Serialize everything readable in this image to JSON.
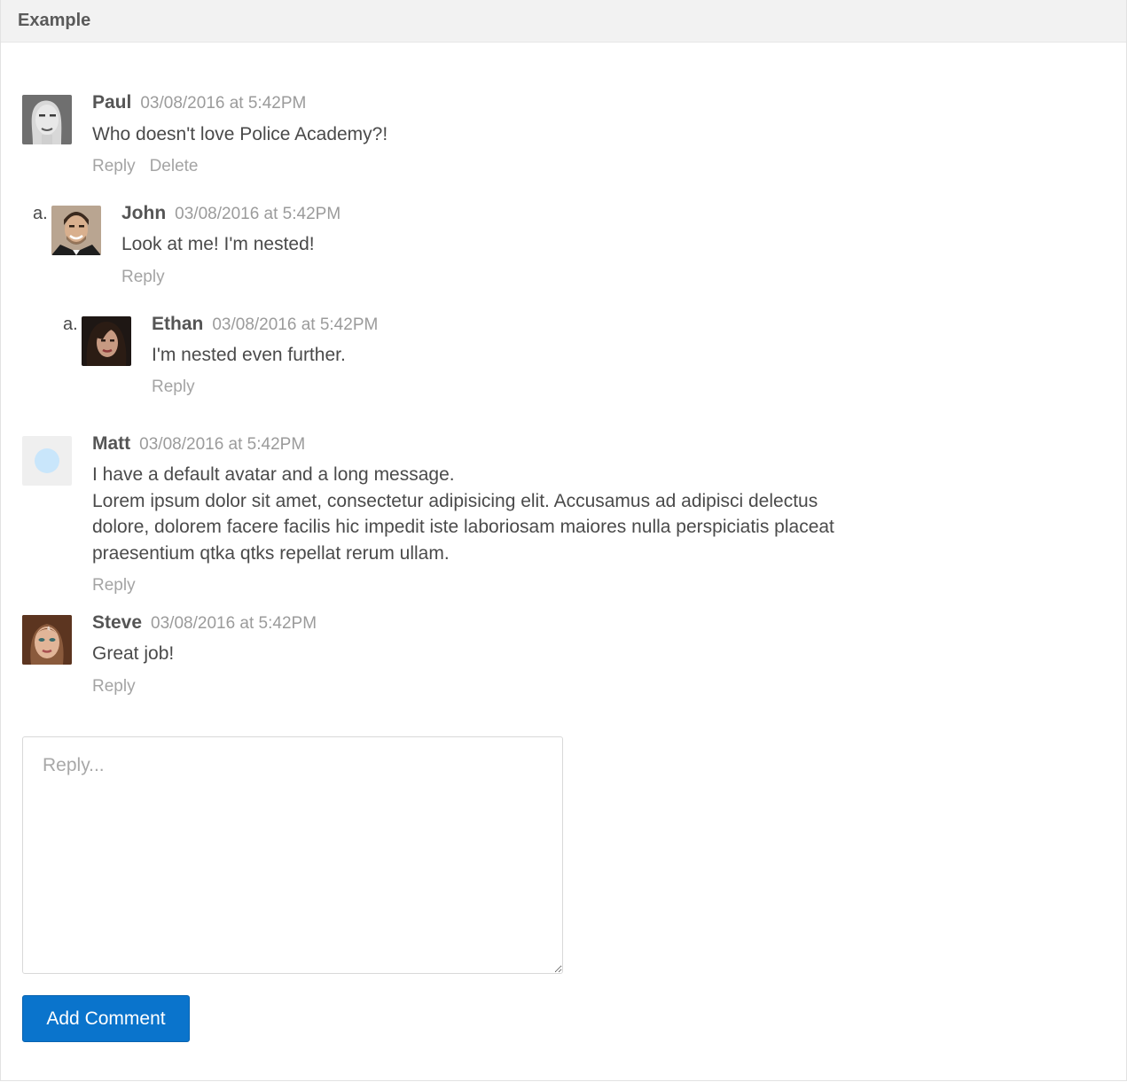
{
  "header": {
    "title": "Example"
  },
  "comments": [
    {
      "author": "Paul",
      "timestamp": "03/08/2016 at 5:42PM",
      "message": [
        "Who doesn't love Police Academy?!"
      ],
      "actions": {
        "reply": "Reply",
        "delete": "Delete"
      }
    },
    {
      "marker": "a.",
      "author": "John",
      "timestamp": "03/08/2016 at 5:42PM",
      "message": [
        "Look at me! I'm nested!"
      ],
      "actions": {
        "reply": "Reply"
      }
    },
    {
      "marker": "a.",
      "author": "Ethan",
      "timestamp": "03/08/2016 at 5:42PM",
      "message": [
        "I'm nested even further."
      ],
      "actions": {
        "reply": "Reply"
      }
    },
    {
      "author": "Matt",
      "timestamp": "03/08/2016 at 5:42PM",
      "message": [
        "I have a default avatar and a long message.",
        "Lorem ipsum dolor sit amet, consectetur adipisicing elit. Accusamus ad adipisci delectus",
        "dolore, dolorem facere facilis hic impedit iste laboriosam maiores nulla perspiciatis placeat",
        "praesentium qtka qtks repellat rerum ullam."
      ],
      "actions": {
        "reply": "Reply"
      }
    },
    {
      "author": "Steve",
      "timestamp": "03/08/2016 at 5:42PM",
      "message": [
        "Great job!"
      ],
      "actions": {
        "reply": "Reply"
      }
    }
  ],
  "reply_form": {
    "placeholder": "Reply...",
    "submit_label": "Add Comment"
  },
  "colors": {
    "button": "#0a74cc",
    "default_avatar_dot": "#c9e6fb",
    "default_avatar_bg": "#efefef"
  }
}
